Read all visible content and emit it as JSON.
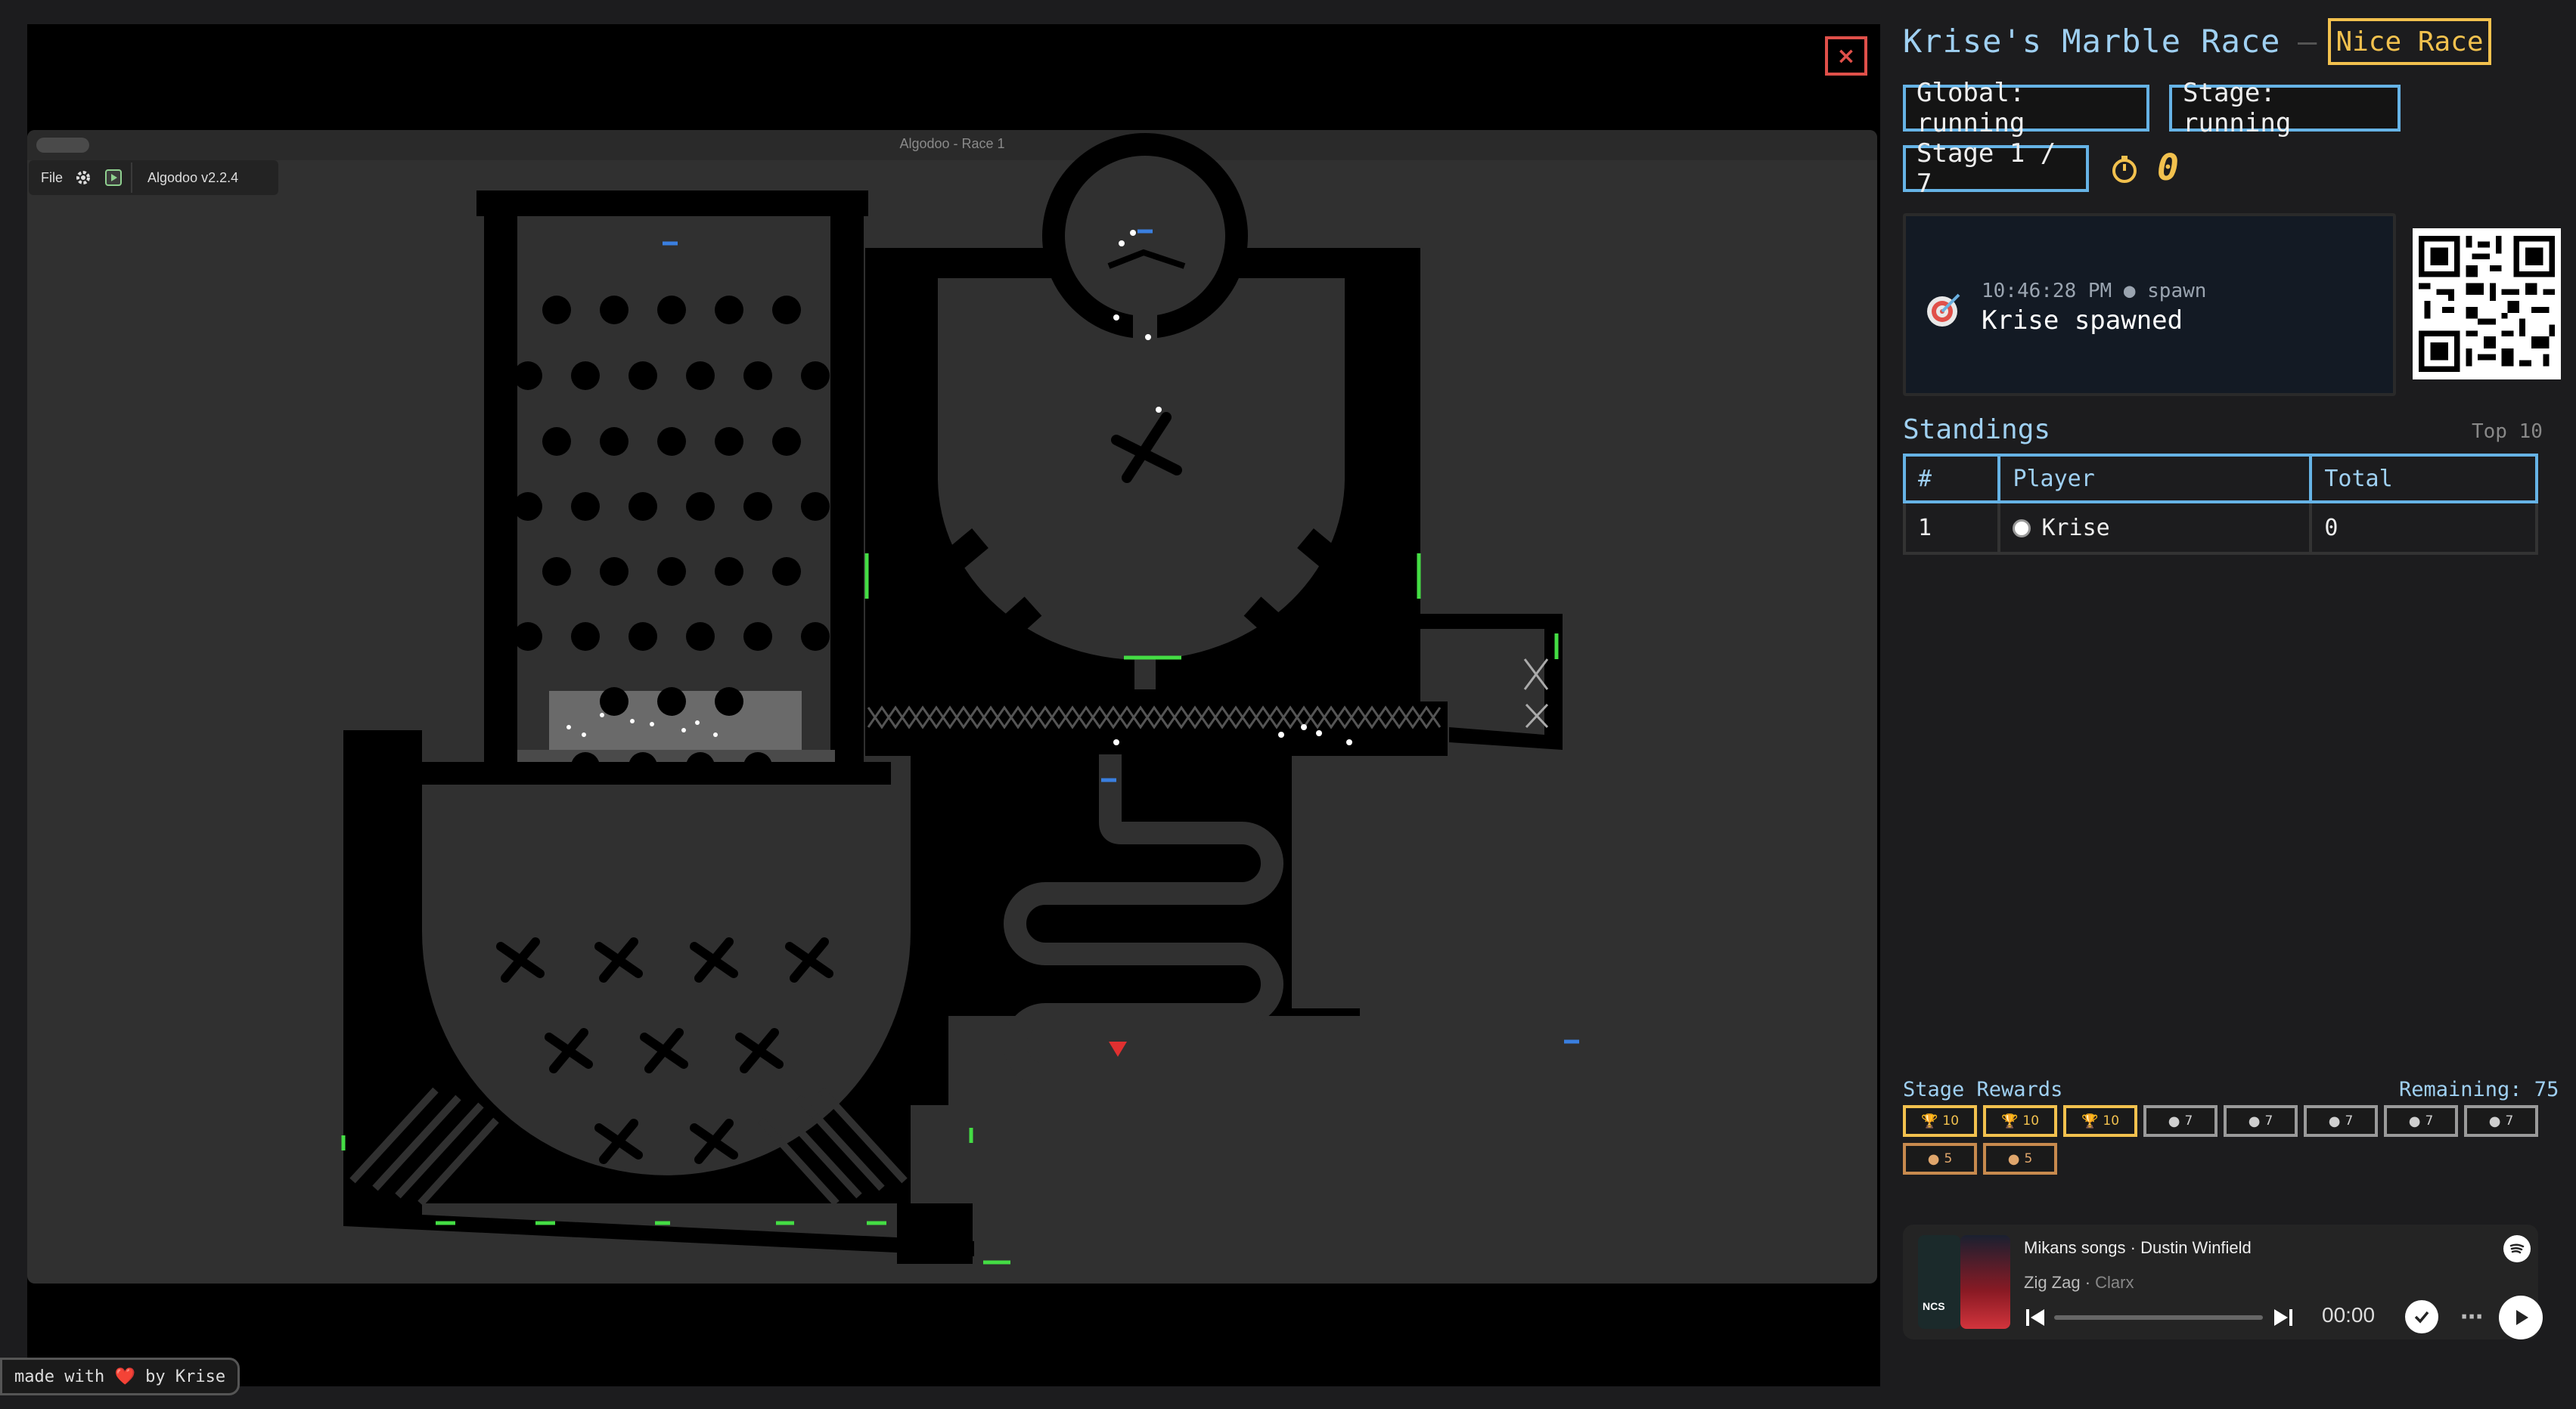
{
  "game": {
    "window_title": "Algodoo - Race 1",
    "toolbar": {
      "file_label": "File",
      "version": "Algodoo v2.2.4"
    },
    "close_label": "×"
  },
  "credit": {
    "prefix": "made with",
    "heart": "❤️",
    "suffix": "by Krise"
  },
  "header": {
    "title": "Krise's Marble Race",
    "separator": "–",
    "badge": "Nice Race"
  },
  "status": {
    "global": "Global: running",
    "stage": "Stage: running",
    "stage_progress": "Stage 1 / 7",
    "timer_icon": "stopwatch-icon",
    "timer_value": "0"
  },
  "event": {
    "icon": "target-icon",
    "time": "10:46:28 PM",
    "type": "spawn",
    "message": "Krise spawned"
  },
  "standings": {
    "title": "Standings",
    "scope": "Top 10",
    "columns": [
      "#",
      "Player",
      "Total"
    ],
    "rows": [
      {
        "rank": "1",
        "player": "Krise",
        "total": "0"
      }
    ]
  },
  "rewards": {
    "label": "Stage Rewards",
    "remaining": "Remaining: 75",
    "items": [
      {
        "tier": "gold",
        "icon": "trophy-icon",
        "points": "10"
      },
      {
        "tier": "gold",
        "icon": "trophy-icon",
        "points": "10"
      },
      {
        "tier": "gold",
        "icon": "trophy-icon",
        "points": "10"
      },
      {
        "tier": "silver",
        "icon": "medal-icon",
        "points": "7"
      },
      {
        "tier": "silver",
        "icon": "medal-icon",
        "points": "7"
      },
      {
        "tier": "silver",
        "icon": "medal-icon",
        "points": "7"
      },
      {
        "tier": "silver",
        "icon": "medal-icon",
        "points": "7"
      },
      {
        "tier": "silver",
        "icon": "medal-icon",
        "points": "7"
      },
      {
        "tier": "bronze",
        "icon": "medal-icon",
        "points": "5"
      },
      {
        "tier": "bronze",
        "icon": "medal-icon",
        "points": "5"
      }
    ]
  },
  "music": {
    "playlist": "Mikans songs",
    "owner": "Dustin Winfield",
    "track": "Zig Zag",
    "artist": "Clarx",
    "time": "00:00",
    "progress": 0,
    "logo_text": "NCS"
  },
  "colors": {
    "accent": "#66b3e6",
    "title": "#9fd0f2",
    "gold": "#f2c14e",
    "silver": "#9a9a9a",
    "bronze": "#c88a4e",
    "close": "#e0504a",
    "marker_green": "#44dd44",
    "marker_blue": "#3a7fe0",
    "marker_red": "#e03030"
  }
}
